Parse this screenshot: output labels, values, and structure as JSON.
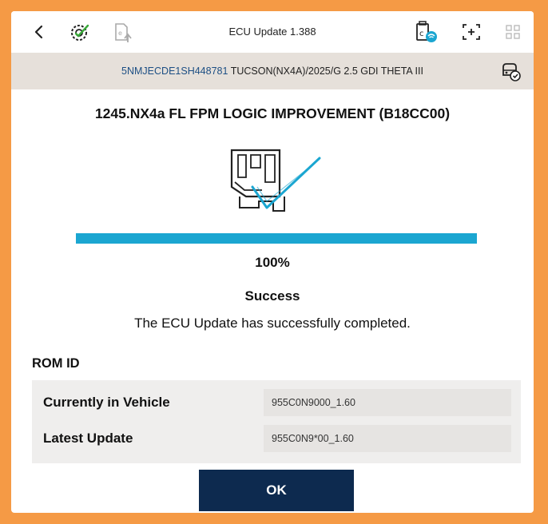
{
  "header": {
    "title": "ECU Update 1.388",
    "icons": [
      "back-icon",
      "ecu-gear-check-icon",
      "export-icon",
      "device-wifi-icon",
      "capture-icon",
      "grid-icon"
    ]
  },
  "vehicle": {
    "vin": "5NMJECDE1SH448781",
    "model": "TUCSON(NX4A)/2025/G 2.5 GDI THETA III",
    "icon": "vehicle-status-icon"
  },
  "update": {
    "title": "1245.NX4a FL FPM LOGIC IMPROVEMENT (B18CC00)",
    "progress_percent": 100,
    "progress_label": "100%",
    "status": "Success",
    "message": "The ECU Update has successfully completed."
  },
  "rom": {
    "label": "ROM ID",
    "rows": [
      {
        "label": "Currently in Vehicle",
        "value": "955C0N9000_1.60"
      },
      {
        "label": "Latest Update",
        "value": "955C0N9*00_1.60"
      }
    ]
  },
  "actions": {
    "ok_label": "OK"
  },
  "colors": {
    "accent": "#1ba6d1",
    "button": "#0d2a4f",
    "frame": "#f59a45",
    "vin": "#1d4f84"
  }
}
